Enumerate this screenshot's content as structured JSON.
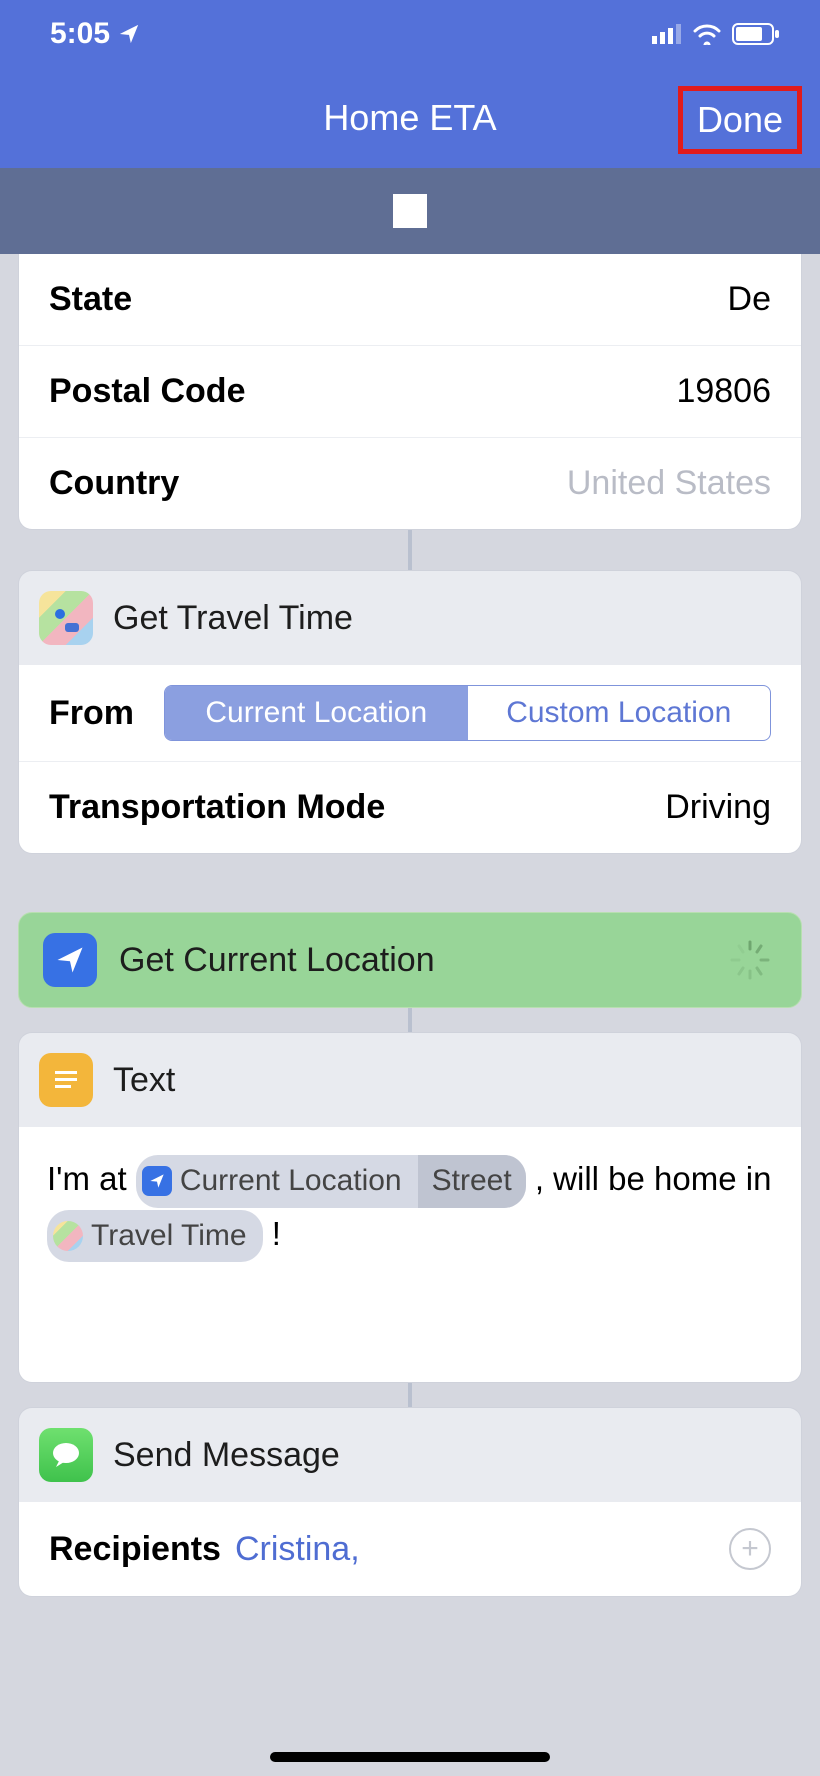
{
  "statusbar": {
    "time": "5:05"
  },
  "nav": {
    "title": "Home ETA",
    "done": "Done"
  },
  "address": {
    "state_k": "State",
    "state_v": "De",
    "postal_k": "Postal Code",
    "postal_v": "19806",
    "country_k": "Country",
    "country_v": "United States"
  },
  "travel": {
    "title": "Get Travel Time",
    "from_k": "From",
    "seg_current": "Current Location",
    "seg_custom": "Custom Location",
    "mode_k": "Transportation Mode",
    "mode_v": "Driving"
  },
  "getloc": {
    "title": "Get Current Location"
  },
  "text": {
    "title": "Text",
    "p1a": "I'm at ",
    "token1": "Current Location",
    "token1_sub": "Street",
    "p1b": ", will be home in ",
    "token2": "Travel Time",
    "p1c": " !"
  },
  "msg": {
    "title": "Send Message",
    "recip_k": "Recipients",
    "recip_name": "Cristina,"
  }
}
